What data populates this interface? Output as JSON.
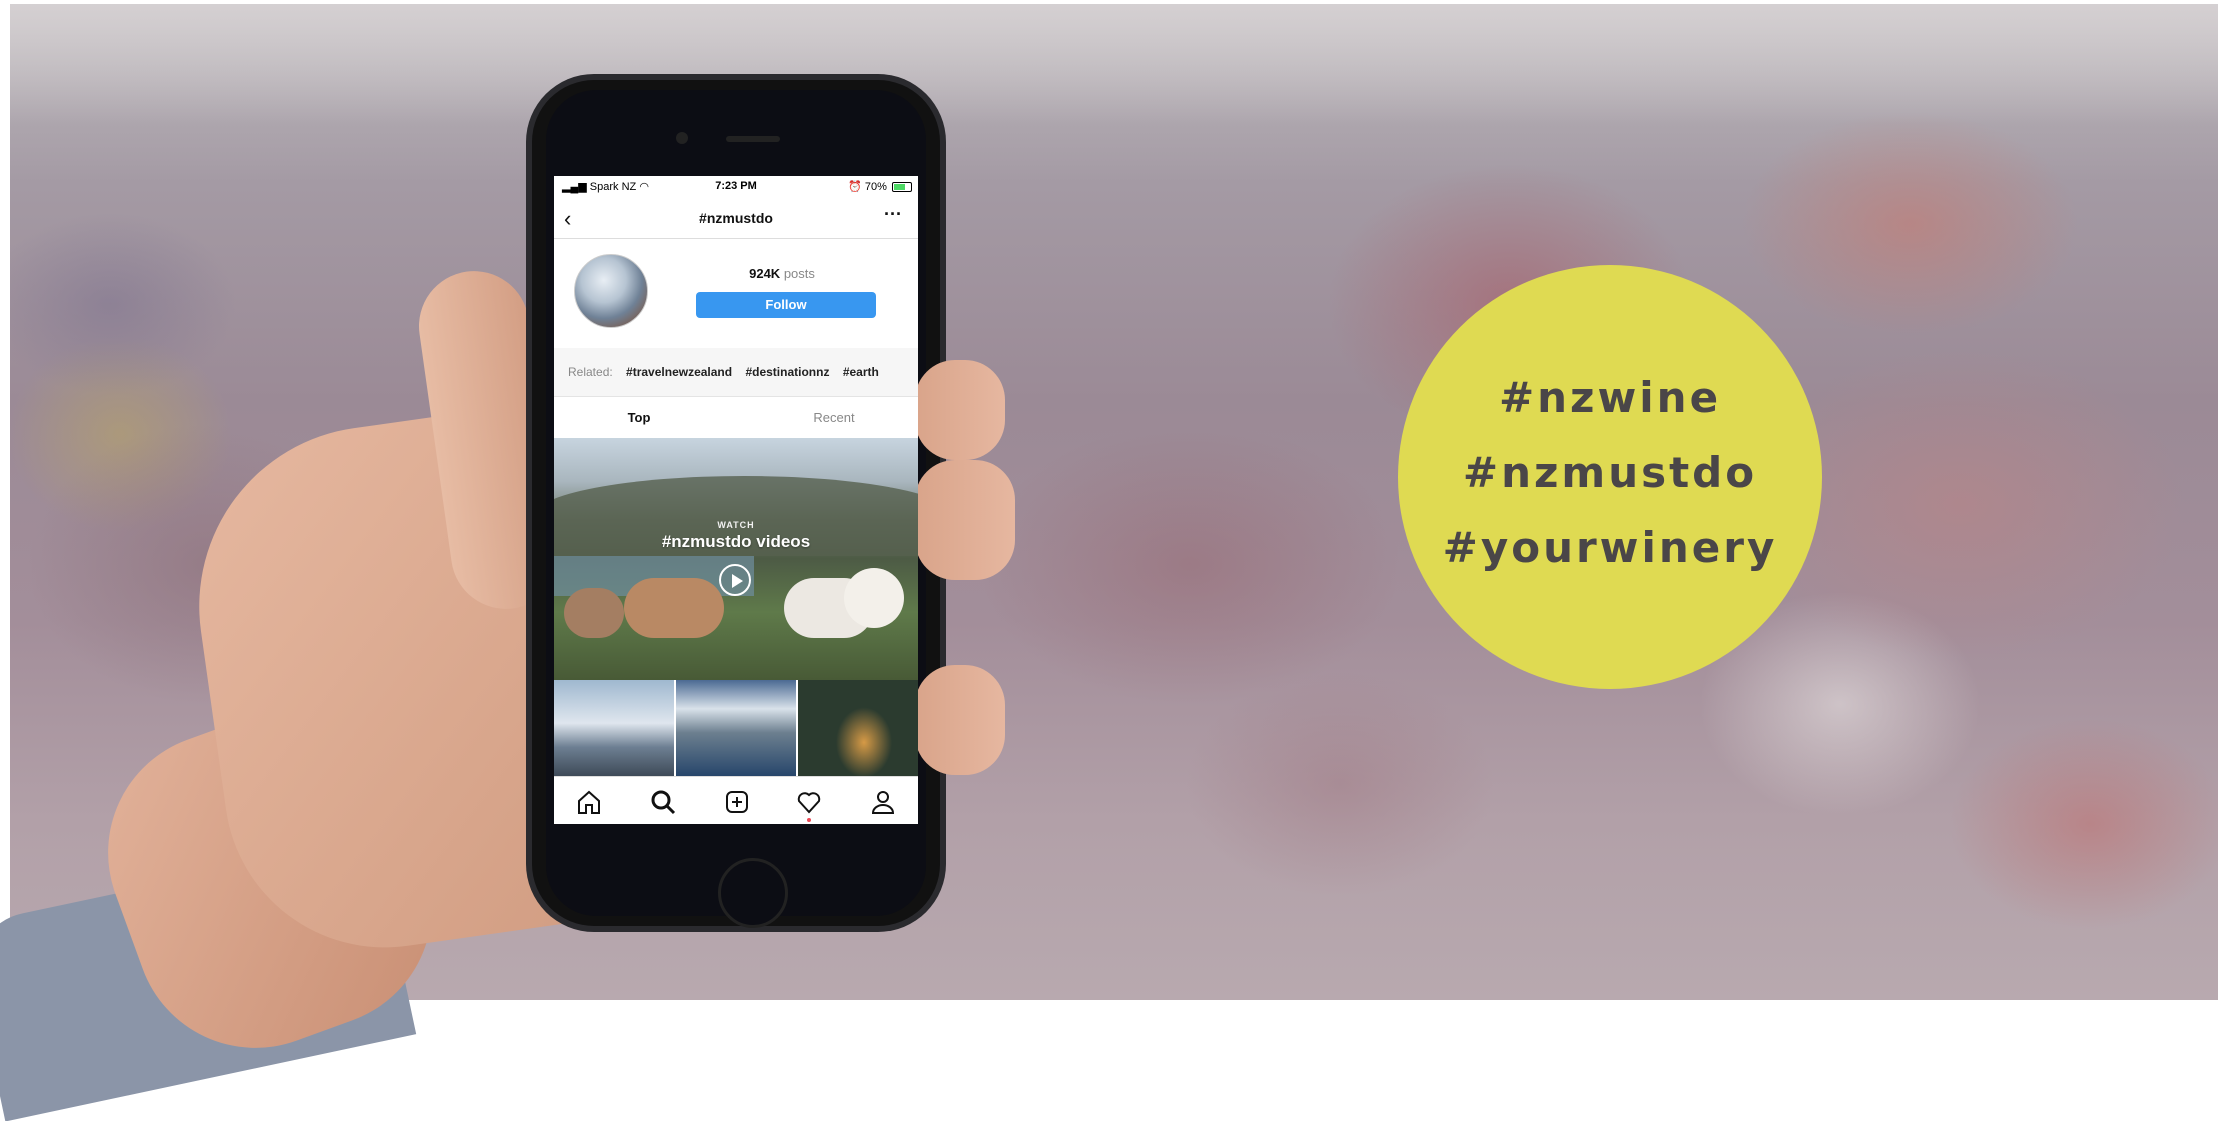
{
  "status_bar": {
    "carrier": "Spark NZ",
    "time": "7:23 PM",
    "battery": "70%"
  },
  "nav": {
    "title": "#nzmustdo"
  },
  "profile": {
    "posts_count": "924K",
    "posts_label": "posts",
    "follow_label": "Follow"
  },
  "related": {
    "label": "Related:",
    "tags": [
      "#travelnewzealand",
      "#destinationnz",
      "#earth"
    ]
  },
  "tabs": {
    "top": "Top",
    "recent": "Recent"
  },
  "video": {
    "label": "WATCH",
    "title": "#nzmustdo videos"
  },
  "tab_bar": {
    "icons": [
      "home-icon",
      "search-icon",
      "add-icon",
      "heart-icon",
      "profile-icon"
    ]
  },
  "badge": {
    "color": "#dfda52",
    "lines": [
      "#nzwine",
      "#nzmustdo",
      "#yourwinery"
    ]
  }
}
